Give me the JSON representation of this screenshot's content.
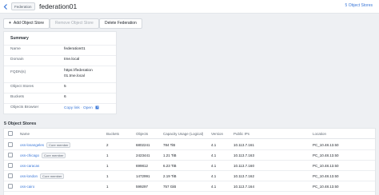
{
  "header": {
    "badge": "Federation",
    "title": "federation01",
    "object_stores_count": "5 Object Stores"
  },
  "toolbar": {
    "add_label": "Add Object Store",
    "remove_label": "Remove Object Store",
    "delete_label": "Delete Federation"
  },
  "summary": {
    "title": "Summary",
    "rows": [
      {
        "key": "Name",
        "value": "federation01"
      },
      {
        "key": "Domain",
        "value": "tme.local"
      },
      {
        "key": "FQDN(s)",
        "value": "https://federation01.tme.local"
      },
      {
        "key": "Object Stores",
        "value": "5"
      },
      {
        "key": "Buckets",
        "value": "6"
      },
      {
        "key": "Objects Browser",
        "copy": "Copy link",
        "open": "Open"
      }
    ]
  },
  "stores": {
    "title": "5 Object Stores",
    "columns": [
      "Name",
      "Buckets",
      "Objects",
      "Capacity Usage (Logical)",
      "Version",
      "Public IPs",
      "Location"
    ],
    "rows": [
      {
        "name": "oss-losangeles",
        "badge": "Core member",
        "buckets": "2",
        "objects": "6802241",
        "capacity": "784 TiB",
        "version": "4.1",
        "ips": "10.113.7.161",
        "location": "PC_10.48.13.50"
      },
      {
        "name": "oss-chicago",
        "badge": "Core member",
        "buckets": "1",
        "objects": "2423441",
        "capacity": "1.21 TiB",
        "version": "4.1",
        "ips": "10.113.7.163",
        "location": "PC_10.48.13.50"
      },
      {
        "name": "oss-caracas",
        "badge": "",
        "buckets": "1",
        "objects": "699812",
        "capacity": "6.23 TiB",
        "version": "4.1",
        "ips": "10.113.7.160",
        "location": "PC_10.48.13.50"
      },
      {
        "name": "oss-london",
        "badge": "Core member",
        "buckets": "1",
        "objects": "1472991",
        "capacity": "2.19 TiB",
        "version": "4.1",
        "ips": "10.113.7.162",
        "location": "PC_10.48.13.50"
      },
      {
        "name": "oss-cairo",
        "badge": "",
        "buckets": "1",
        "objects": "599297",
        "capacity": "757 GiB",
        "version": "4.1",
        "ips": "10.113.7.164",
        "location": "PC_10.48.13.50"
      }
    ]
  },
  "icons": {
    "back": "chevron-left-icon",
    "add": "plus-icon",
    "open": "external-link-icon"
  }
}
